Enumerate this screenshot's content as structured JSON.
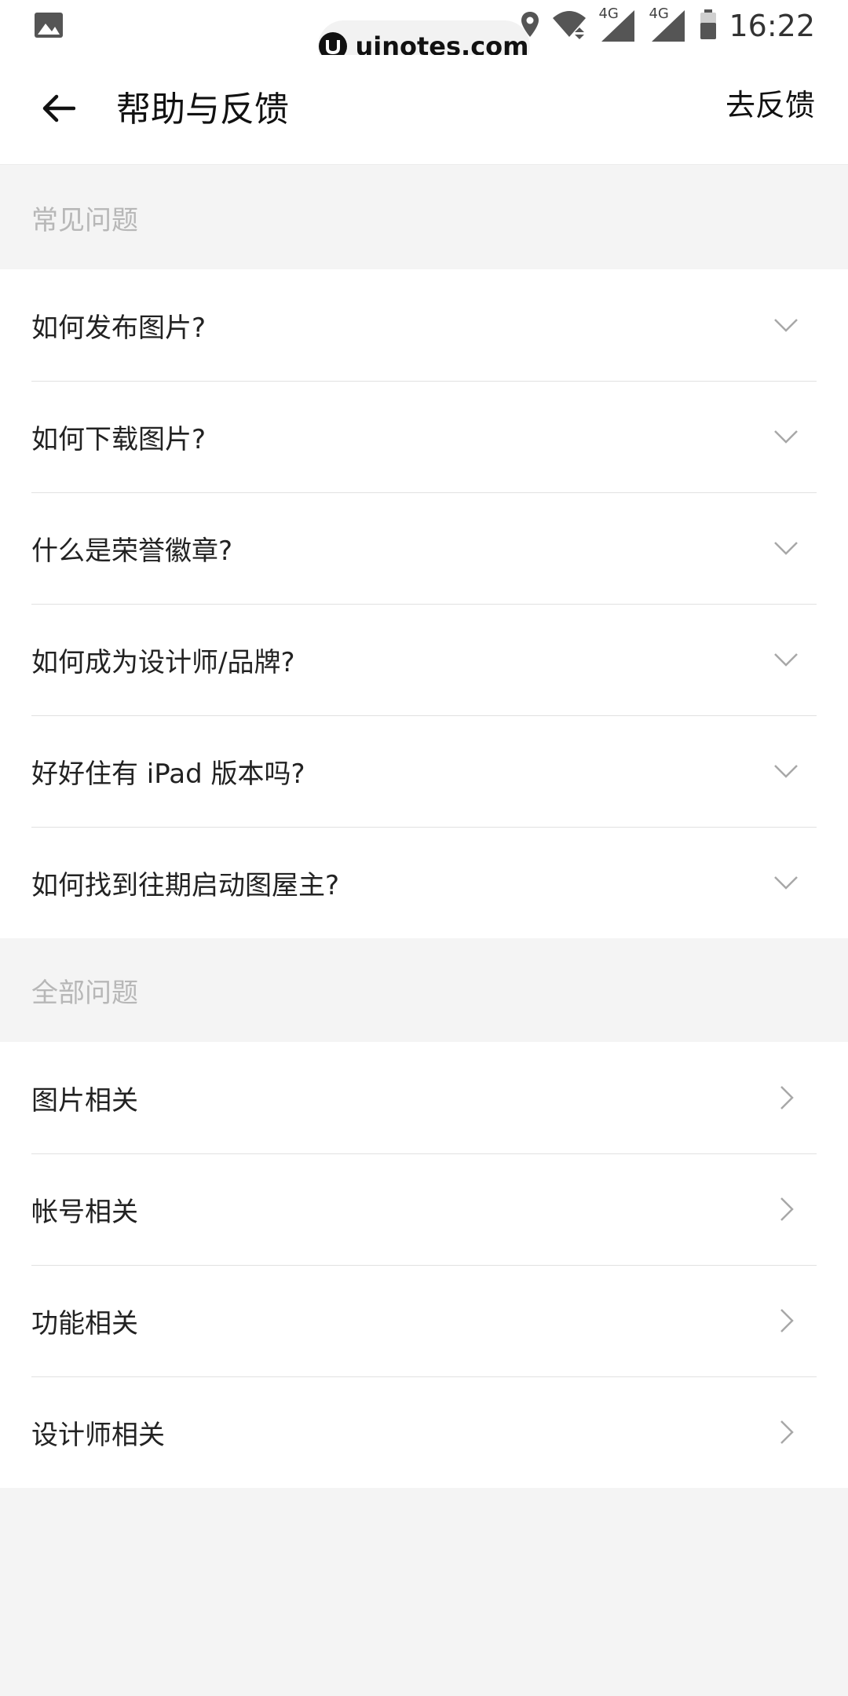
{
  "status_bar": {
    "time": "16:22",
    "network_1": "4G",
    "network_2": "4G",
    "watermark": "uinotes.com",
    "icons": [
      "image-icon",
      "location-icon",
      "wifi-icon",
      "signal-icon",
      "signal-icon",
      "battery-icon"
    ]
  },
  "header": {
    "title": "帮助与反馈",
    "action": "去反馈",
    "back_icon": "back-arrow-icon"
  },
  "faq": {
    "section_title": "常见问题",
    "items": [
      {
        "label": "如何发布图片?",
        "icon": "chevron-down-icon"
      },
      {
        "label": "如何下载图片?",
        "icon": "chevron-down-icon"
      },
      {
        "label": "什么是荣誉徽章?",
        "icon": "chevron-down-icon"
      },
      {
        "label": "如何成为设计师/品牌?",
        "icon": "chevron-down-icon"
      },
      {
        "label": "好好住有 iPad 版本吗?",
        "icon": "chevron-down-icon"
      },
      {
        "label": "如何找到往期启动图屋主?",
        "icon": "chevron-down-icon"
      }
    ]
  },
  "all": {
    "section_title": "全部问题",
    "items": [
      {
        "label": "图片相关",
        "icon": "chevron-right-icon"
      },
      {
        "label": "帐号相关",
        "icon": "chevron-right-icon"
      },
      {
        "label": "功能相关",
        "icon": "chevron-right-icon"
      },
      {
        "label": "设计师相关",
        "icon": "chevron-right-icon"
      }
    ]
  },
  "colors": {
    "background": "#f4f4f4",
    "surface": "#ffffff",
    "section_text": "#b7b7b7",
    "divider": "#e1e1e1",
    "chevron": "#a8a8a8"
  }
}
